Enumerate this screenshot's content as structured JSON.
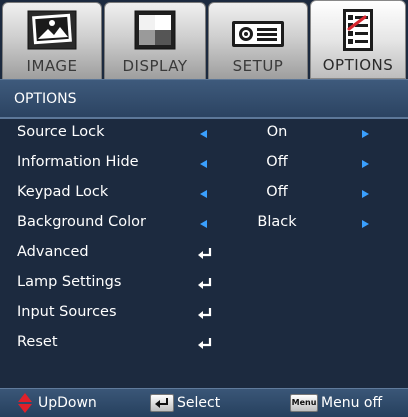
{
  "tabs": [
    {
      "label": "IMAGE",
      "icon": "image-icon",
      "active": false
    },
    {
      "label": "DISPLAY",
      "icon": "display-icon",
      "active": false
    },
    {
      "label": "SETUP",
      "icon": "projector-icon",
      "active": false
    },
    {
      "label": "OPTIONS",
      "icon": "checklist-icon",
      "active": true
    }
  ],
  "title": "OPTIONS",
  "settings": [
    {
      "label": "Source Lock",
      "value": "On"
    },
    {
      "label": "Information Hide",
      "value": "Off"
    },
    {
      "label": "Keypad Lock",
      "value": "Off"
    },
    {
      "label": "Background Color",
      "value": "Black"
    }
  ],
  "submenus": [
    {
      "label": "Advanced"
    },
    {
      "label": "Lamp Settings"
    },
    {
      "label": "Input Sources"
    },
    {
      "label": "Reset"
    }
  ],
  "footer": {
    "updown": "UpDown",
    "select": "Select",
    "menu_key": "Menu",
    "menu_off": "Menu off"
  },
  "colors": {
    "background": "#1c2a3f",
    "title_bar": "#34506f",
    "arrow": "#3aa0ff",
    "updown_icon": "#e0202a"
  }
}
